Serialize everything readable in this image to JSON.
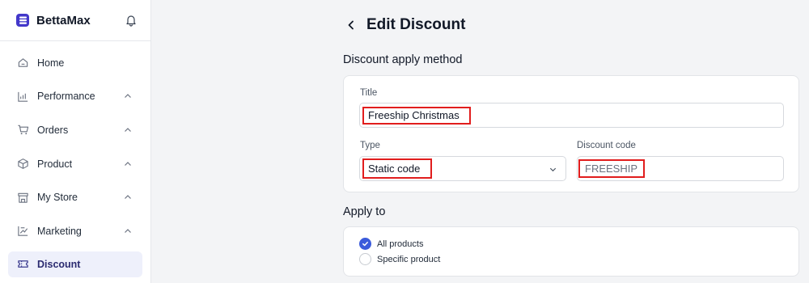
{
  "app": {
    "name": "BettaMax"
  },
  "sidebar": {
    "items": [
      {
        "label": "Home",
        "icon": "home-icon",
        "expandable": false
      },
      {
        "label": "Performance",
        "icon": "chart-icon",
        "expandable": true
      },
      {
        "label": "Orders",
        "icon": "cart-icon",
        "expandable": true
      },
      {
        "label": "Product",
        "icon": "box-icon",
        "expandable": true
      },
      {
        "label": "My Store",
        "icon": "store-icon",
        "expandable": true
      },
      {
        "label": "Marketing",
        "icon": "marketing-icon",
        "expandable": true
      },
      {
        "label": "Discount",
        "icon": "ticket-icon",
        "active": true
      }
    ]
  },
  "page": {
    "title": "Edit Discount"
  },
  "apply_method": {
    "heading": "Discount apply method",
    "title_label": "Title",
    "title_value": "Freeship Christmas",
    "type_label": "Type",
    "type_value": "Static code",
    "code_label": "Discount code",
    "code_value": "FREESHIP"
  },
  "apply_to": {
    "heading": "Apply to",
    "options": [
      {
        "label": "All products",
        "checked": true
      },
      {
        "label": "Specific product",
        "checked": false
      }
    ]
  },
  "colors": {
    "accent": "#3b5bdb",
    "highlight": "#e11d1d",
    "active_bg": "#eef0fb"
  }
}
